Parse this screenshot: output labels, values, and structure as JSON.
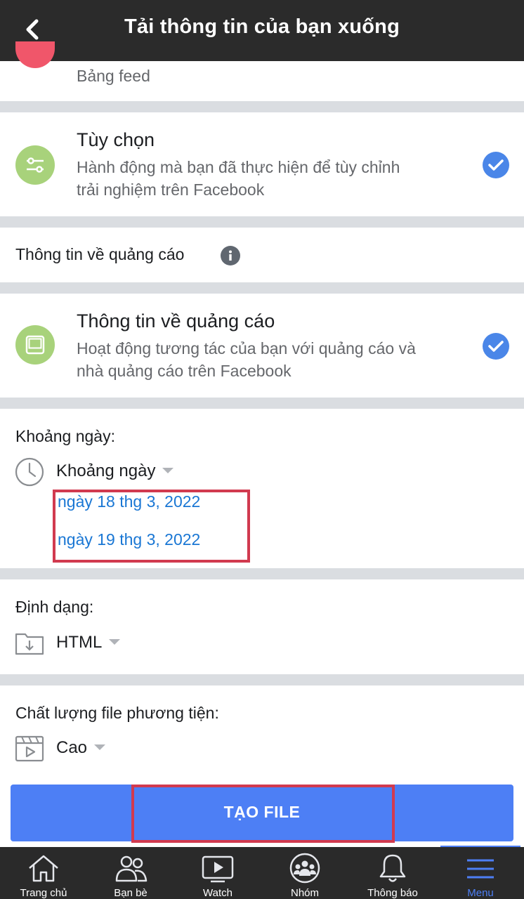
{
  "header": {
    "title": "Tải thông tin của bạn xuống"
  },
  "top_item": {
    "desc": "Bảng feed"
  },
  "items": [
    {
      "title": "Tùy chọn",
      "desc_line1": "Hành động mà bạn đã thực hiện để tùy chỉnh",
      "desc_line2": "trải nghiệm trên Facebook",
      "checked": true,
      "icon": "sliders-icon"
    },
    {
      "title": "Thông tin về quảng cáo",
      "desc_line1": "Hoạt động tương tác của bạn với quảng cáo và",
      "desc_line2": "nhà quảng cáo trên Facebook",
      "checked": true,
      "icon": "tablet-icon"
    }
  ],
  "ads_section": {
    "heading": "Thông tin về quảng cáo",
    "info_icon": "info-icon"
  },
  "date_range": {
    "label": "Khoảng ngày:",
    "value": "Khoảng ngày",
    "start": "ngày 18 thg 3, 2022",
    "end": "ngày 19 thg 3, 2022"
  },
  "format": {
    "label": "Định dạng:",
    "value": "HTML"
  },
  "quality": {
    "label": "Chất lượng file phương tiện:",
    "value": "Cao"
  },
  "create_button": {
    "label": "TẠO FILE"
  },
  "tabs": [
    {
      "label": "Trang chủ",
      "icon": "home-icon"
    },
    {
      "label": "Bạn bè",
      "icon": "friends-icon"
    },
    {
      "label": "Watch",
      "icon": "watch-icon"
    },
    {
      "label": "Nhóm",
      "icon": "groups-icon"
    },
    {
      "label": "Thông báo",
      "icon": "bell-icon"
    },
    {
      "label": "Menu",
      "icon": "menu-icon",
      "active": true
    }
  ],
  "colors": {
    "accent": "#4d7ff5",
    "header": "#2b2b2b",
    "highlight": "#d13a4f",
    "link": "#1a77d4"
  }
}
